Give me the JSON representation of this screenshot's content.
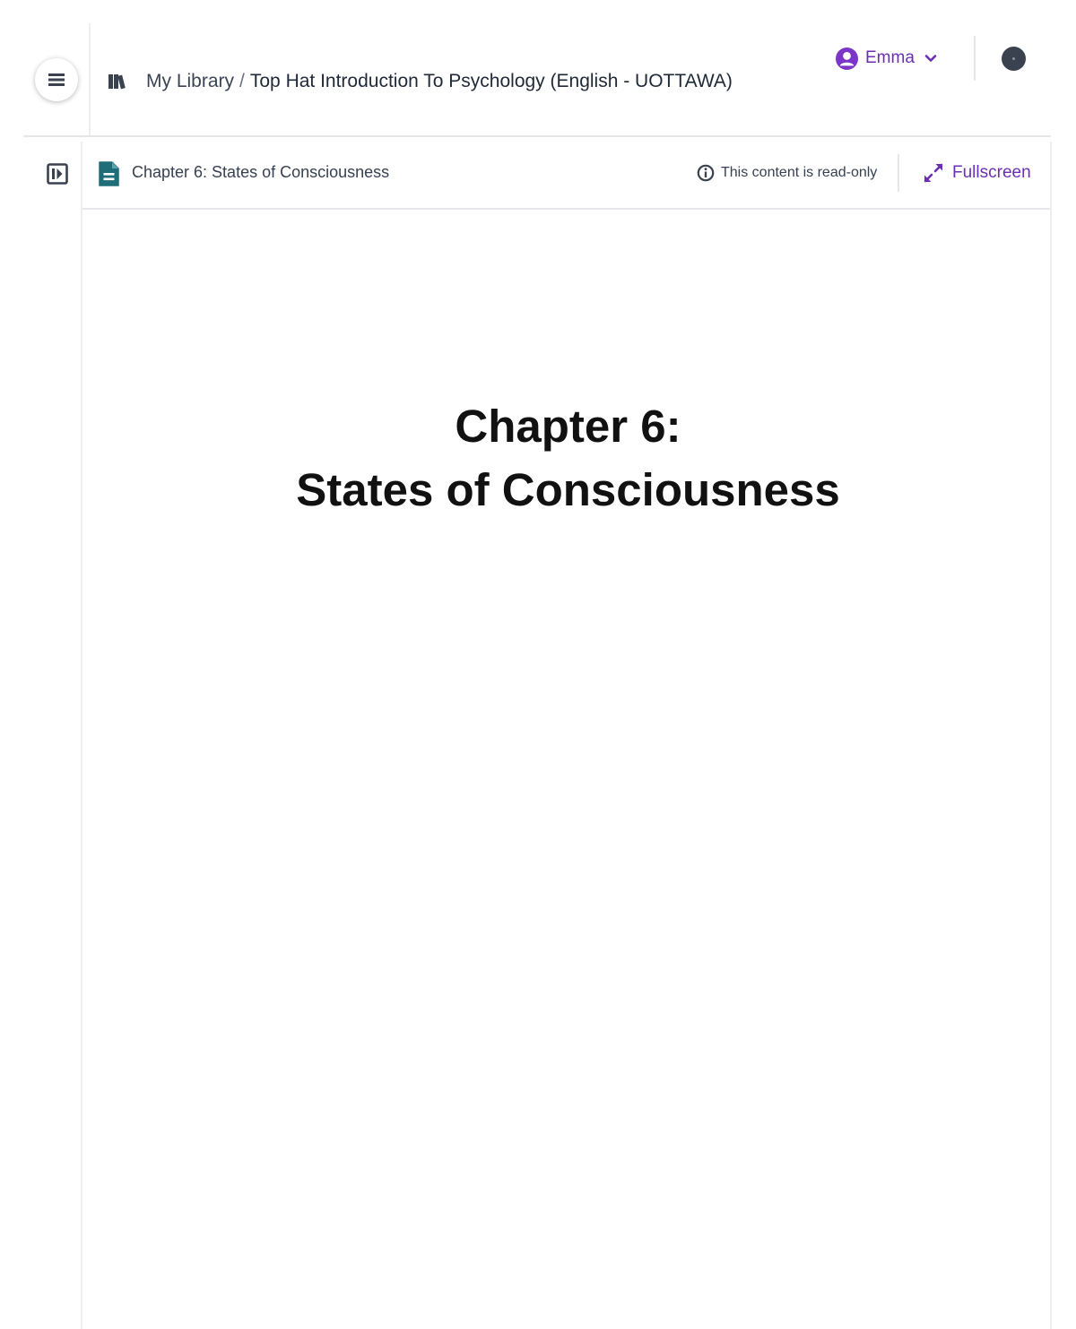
{
  "header": {
    "breadcrumb": {
      "library_label": "My Library",
      "separator": "/",
      "course_title": "Top Hat Introduction To Psychology (English - UOTTAWA)"
    },
    "user": {
      "name": "Emma"
    }
  },
  "content": {
    "doc_title": "Chapter 6: States of Consciousness",
    "readonly_label": "This content is read-only",
    "fullscreen_label": "Fullscreen"
  },
  "slide": {
    "title_line1": "Chapter 6:",
    "title_line2": "States of Consciousness"
  },
  "colors": {
    "accent": "#6b2fb3",
    "doc_icon": "#1f6d78",
    "icon_dark": "#3a4250"
  },
  "icons": {
    "menu": "hamburger-icon",
    "library": "books-icon",
    "user": "user-avatar-icon",
    "dropdown": "chevron-down-icon",
    "help": "help-icon",
    "sidebar": "sidebar-toggle-icon",
    "document": "document-icon",
    "info": "info-icon",
    "fullscreen": "expand-icon"
  }
}
